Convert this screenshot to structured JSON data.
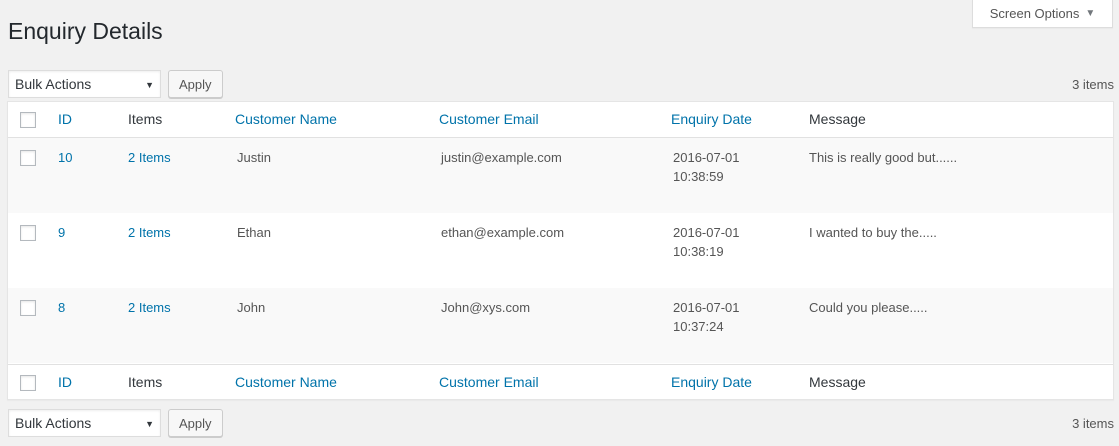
{
  "screen_options": {
    "label": "Screen Options",
    "icon": "triangle-down-icon"
  },
  "page_title": "Enquiry Details",
  "bulk_top": {
    "selected": "Bulk Actions",
    "apply_label": "Apply",
    "count": "3 items"
  },
  "bulk_bottom": {
    "selected": "Bulk Actions",
    "apply_label": "Apply",
    "count": "3 items"
  },
  "columns": {
    "id": "ID",
    "items": "Items",
    "customer_name": "Customer Name",
    "customer_email": "Customer Email",
    "enquiry_date": "Enquiry Date",
    "message": "Message"
  },
  "rows": [
    {
      "id": "10",
      "items": "2 Items",
      "name": "Justin",
      "email": "justin@example.com",
      "date": "2016-07-01",
      "time": "10:38:59",
      "message": "This is really good but......"
    },
    {
      "id": "9",
      "items": "2 Items",
      "name": "Ethan",
      "email": "ethan@example.com",
      "date": "2016-07-01",
      "time": "10:38:19",
      "message": "I wanted to buy the....."
    },
    {
      "id": "8",
      "items": "2 Items",
      "name": "John",
      "email": "John@xys.com",
      "date": "2016-07-01",
      "time": "10:37:24",
      "message": "Could you please....."
    }
  ],
  "colors": {
    "link": "#0073aa",
    "background": "#f1f1f1",
    "text": "#23282d"
  }
}
